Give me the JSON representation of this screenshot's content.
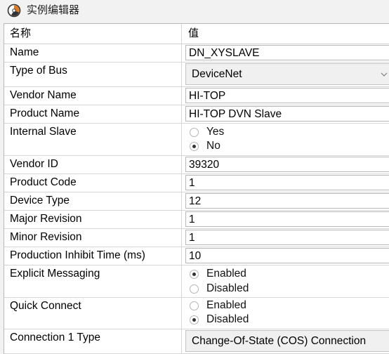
{
  "window": {
    "title": "实例编辑器"
  },
  "table": {
    "header": {
      "name": "名称",
      "value": "值"
    },
    "rows": {
      "name": {
        "label": "Name",
        "value": "DN_XYSLAVE"
      },
      "type_of_bus": {
        "label": "Type of Bus",
        "value": "DeviceNet"
      },
      "vendor_name": {
        "label": "Vendor Name",
        "value": "HI-TOP"
      },
      "product_name": {
        "label": "Product Name",
        "value": "HI-TOP DVN Slave"
      },
      "internal_slave": {
        "label": "Internal Slave",
        "options": [
          "Yes",
          "No"
        ],
        "selected": "No"
      },
      "vendor_id": {
        "label": "Vendor ID",
        "value": "39320"
      },
      "product_code": {
        "label": "Product Code",
        "value": "1"
      },
      "device_type": {
        "label": "Device Type",
        "value": "12"
      },
      "major_revision": {
        "label": "Major Revision",
        "value": "1"
      },
      "minor_revision": {
        "label": "Minor Revision",
        "value": "1"
      },
      "production_inhibit_time": {
        "label": "Production Inhibit Time (ms)",
        "value": "10"
      },
      "explicit_messaging": {
        "label": "Explicit Messaging",
        "options": [
          "Enabled",
          "Disabled"
        ],
        "selected": "Enabled"
      },
      "quick_connect": {
        "label": "Quick Connect",
        "options": [
          "Enabled",
          "Disabled"
        ],
        "selected": "Disabled"
      },
      "connection_1_type": {
        "label": "Connection 1 Type",
        "value": "Change-Of-State (COS) Connection"
      }
    }
  },
  "icons": {
    "title": "app-logo-icon",
    "dropdown": "chevron-down-icon"
  },
  "colors": {
    "grid_line": "#d6d6d6",
    "background": "#f2f2f2",
    "cell_bg": "#ffffff"
  }
}
